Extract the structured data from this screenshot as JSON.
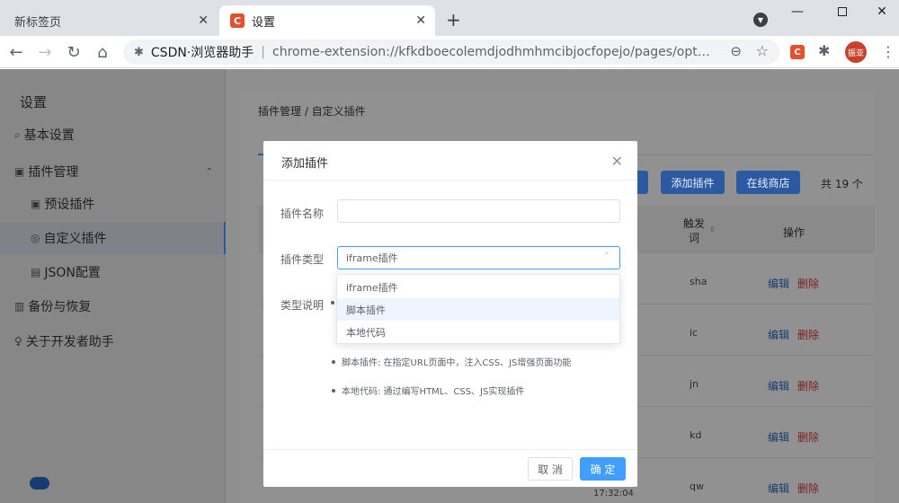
{
  "browser": {
    "tabs": [
      {
        "label": "新标签页"
      },
      {
        "label": "设置",
        "favicon": "C"
      }
    ],
    "omnibox": {
      "site": "CSDN·浏览器助手",
      "url": "chrome-extension://kfkdboecolemdjodhmhmcibjocfopejo/pages/optio..."
    },
    "avatar_text": "振亚"
  },
  "sidebar": {
    "title": "设置",
    "items": [
      {
        "label": "基本设置",
        "icon": "search-icon"
      },
      {
        "label": "插件管理",
        "icon": "plugin-icon"
      },
      {
        "label": "预设插件",
        "icon": "preset-icon"
      },
      {
        "label": "自定义插件",
        "icon": "globe-icon"
      },
      {
        "label": "JSON配置",
        "icon": "json-icon"
      },
      {
        "label": "备份与恢复",
        "icon": "backup-icon"
      },
      {
        "label": "关于开发者助手",
        "icon": "bulb-icon"
      }
    ]
  },
  "main": {
    "breadcrumb": "插件管理 / 自定义插件",
    "buttons": {
      "add_plugin": "添加插件",
      "online_store": "在线商店"
    },
    "total": "共 19 个",
    "columns": {
      "trigger": "触发词",
      "action": "操作"
    },
    "rows": [
      {
        "trigger": "sha"
      },
      {
        "trigger": "ic"
      },
      {
        "trigger": "jn"
      },
      {
        "trigger": "kd"
      },
      {
        "trigger": "qw"
      }
    ],
    "row_actions": {
      "edit": "编辑",
      "delete": "删除"
    },
    "last_row_time": "17:32:04"
  },
  "dialog": {
    "title": "添加插件",
    "name_label": "插件名称",
    "name_value": "",
    "type_label": "插件类型",
    "type_selected": "iframe插件",
    "type_options": [
      "iframe插件",
      "脚本插件",
      "本地代码"
    ],
    "desc_label": "类型说明",
    "desc_items": [
      "脚本插件: 在指定URL页面中，注入CSS、JS增强页面功能",
      "本地代码: 通过编写HTML、CSS、JS实现插件"
    ],
    "cancel": "取 消",
    "confirm": "确 定"
  },
  "colors": {
    "primary": "#409eff",
    "csdn": "#e2512e",
    "mask": "#8f8f8f"
  }
}
